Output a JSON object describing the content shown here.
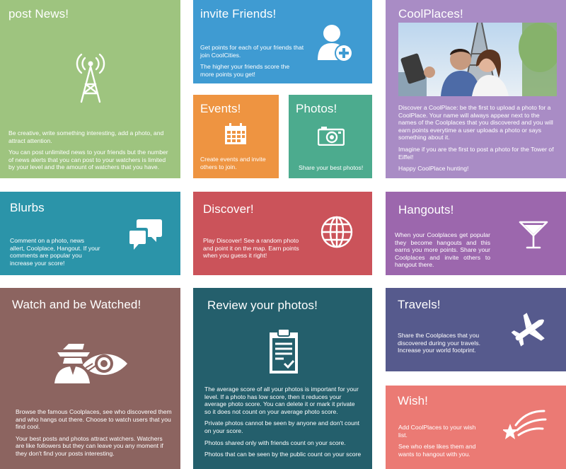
{
  "tiles": {
    "post_news": {
      "title": "post News!",
      "icon": "radio-tower-icon",
      "p1": "Be creative, write something interesting, add a photo, and attract attention.",
      "p2": "You can post unlimited news to your friends but the number of news alerts that you can post to your watchers is limited by your level and the amount of watchers that you have.",
      "color": "#9ec47f"
    },
    "invite_friends": {
      "title": "invite Friends!",
      "icon": "add-user-icon",
      "p1": "Get points for each of your friends that join CoolCities.",
      "p2": "The higher your friends score the more points you get!",
      "color": "#3f9bd2"
    },
    "events": {
      "title": "Events!",
      "icon": "calendar-icon",
      "p1": "Create events and invite others to join.",
      "color": "#ee9441"
    },
    "photos": {
      "title": "Photos!",
      "icon": "camera-icon",
      "p1": "Share your best photos!",
      "color": "#4cab8e"
    },
    "coolplaces": {
      "title": "CoolPlaces!",
      "p1": "Discover a CoolPlace: be the first to upload a photo for a CoolPlace. Your name will always appear next to the names of the Coolplaces that you discovered and you will earn points everytime a user uploads a photo or says something about it.",
      "p2": "Imagine if you are the first to post a photo for the Tower of Eiffel!",
      "p3": "Happy CoolPlace hunting!",
      "color": "#a98cc5"
    },
    "blurbs": {
      "title": "Blurbs",
      "icon": "chat-bubbles-icon",
      "p1": "Comment on a photo, news allert, Coolplace, Hangout. If your comments are popular you increase your score!",
      "color": "#2b94a9"
    },
    "discover": {
      "title": "Discover!",
      "icon": "globe-icon",
      "p1": "Play Discover! See a random photo and point it on the map. Earn points when you guess it right!",
      "color": "#cb535a"
    },
    "hangouts": {
      "title": "Hangouts!",
      "icon": "cocktail-glass-icon",
      "p1": "When your Coolplaces get popular they become hangouts and this earns you more points. Share your Coolplaces and invite others to hangout there.",
      "color": "#9c67ad"
    },
    "watch": {
      "title": "Watch and be Watched!",
      "icon": "spy-eye-icon",
      "p1": "Browse the famous Coolplaces, see who discovered them and who hangs out there. Choose to watch users that you find cool.",
      "p2": "Your best posts and photos attract watchers. Watchers are like followers but they can leave you any moment if they don't find your posts interesting.",
      "color": "#8c6460"
    },
    "review": {
      "title": "Review your photos!",
      "icon": "clipboard-check-icon",
      "p1": "The average score of all your photos is important for your level. If a photo has low score, then it reduces your average photo score. You can delete it or mark it private so it does not count on your average photo score.",
      "p2": "Private photos cannot be seen by anyone and don't count on your score.",
      "p3": "Photos shared only with friends count on your score.",
      "p4": "Photos that can be seen by the public count on your score",
      "color": "#245f6c"
    },
    "travels": {
      "title": "Travels!",
      "icon": "airplane-icon",
      "p1": "Share the Coolplaces that you discovered during your travels. Increase your world footprint.",
      "color": "#565a8d"
    },
    "wish": {
      "title": "Wish!",
      "icon": "shooting-star-icon",
      "p1": "Add CoolPlaces to your wish list.",
      "p2": "See who else likes them and wants to hangout with you.",
      "color": "#eb7a74"
    }
  }
}
